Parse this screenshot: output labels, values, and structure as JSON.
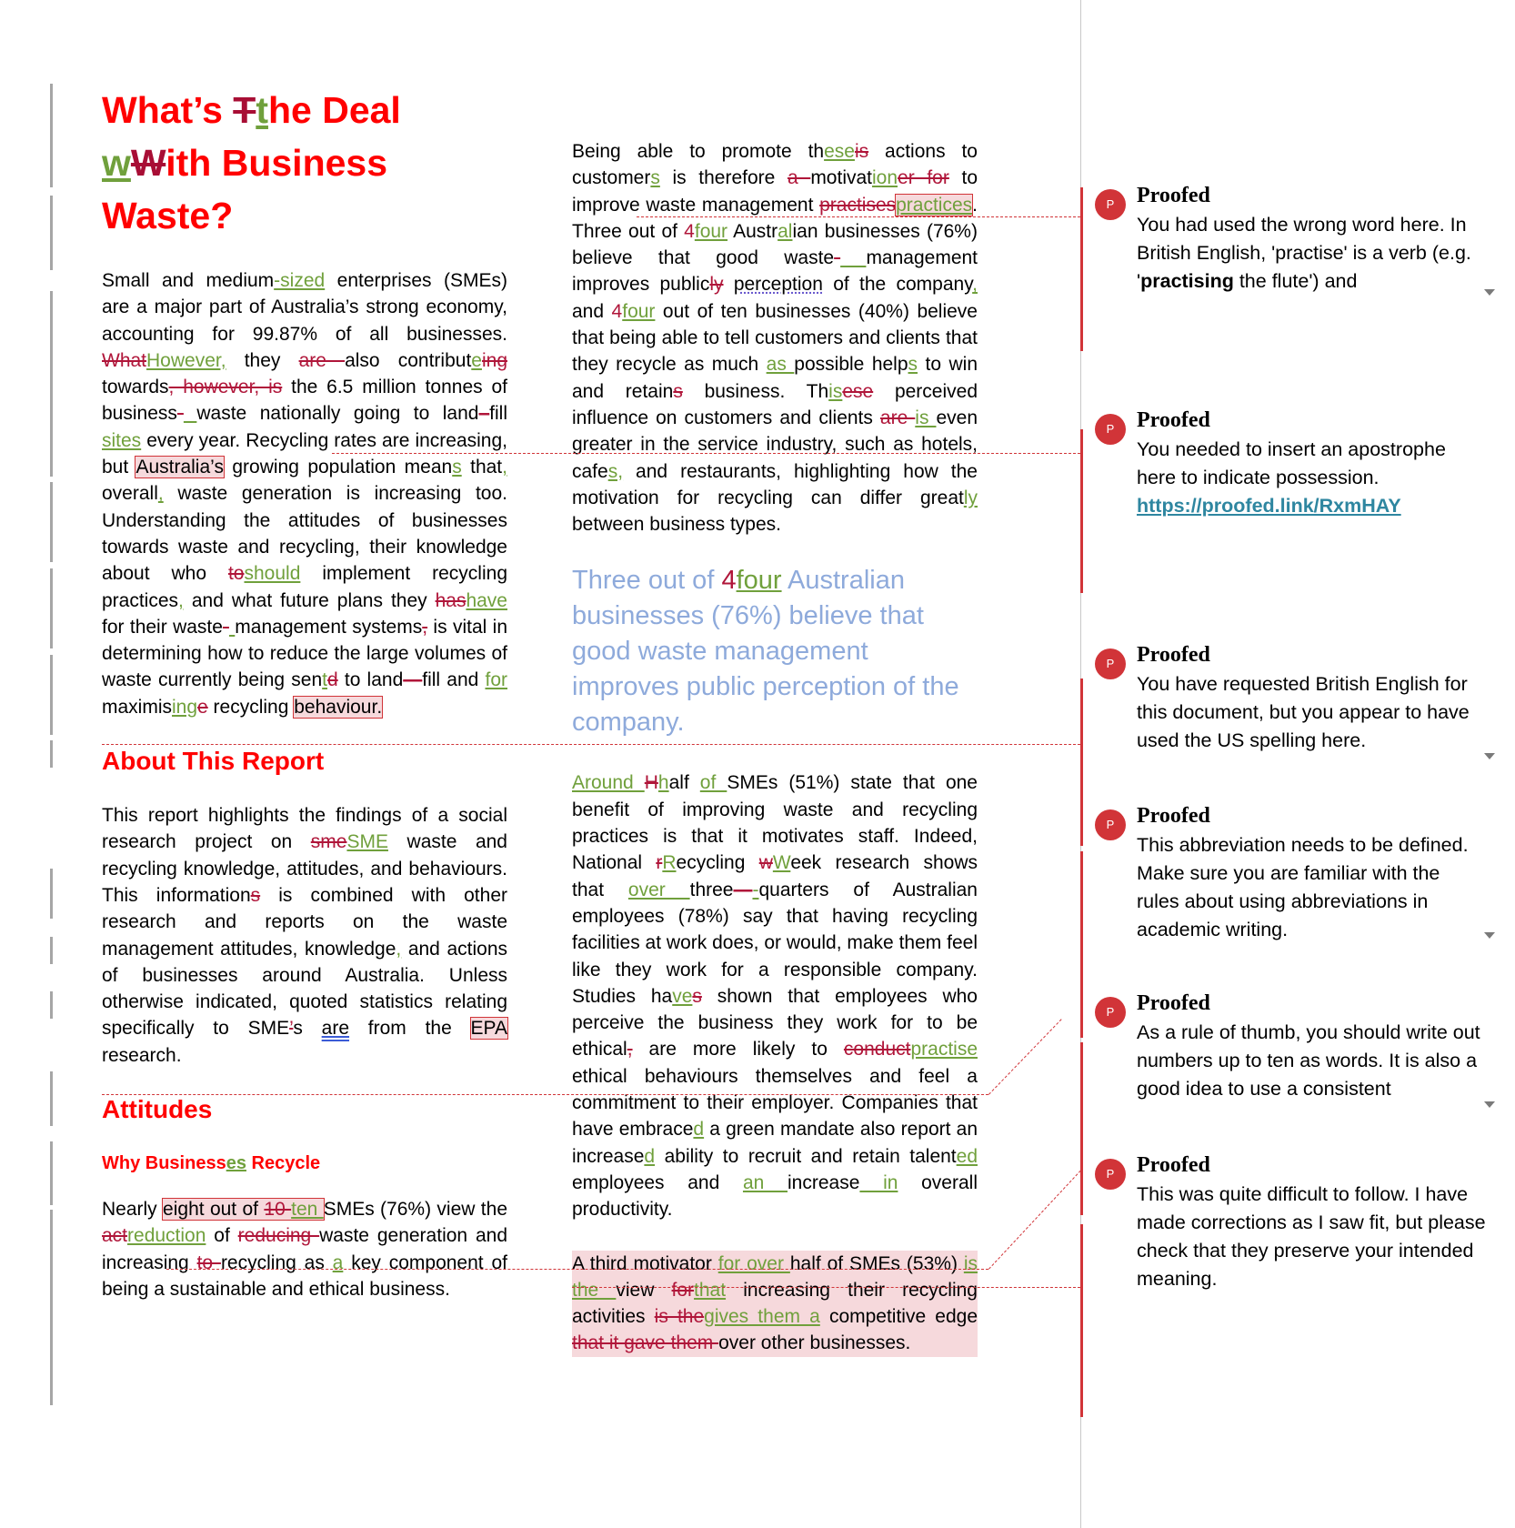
{
  "document": {
    "title_segments": [
      {
        "t": "text",
        "v": "What’s "
      },
      {
        "t": "del",
        "v": "T"
      },
      {
        "t": "ins",
        "v": "t"
      },
      {
        "t": "text",
        "v": "he Deal "
      },
      {
        "t": "ins",
        "v": "w"
      },
      {
        "t": "del",
        "v": "W"
      },
      {
        "t": "text",
        "v": "ith Business Waste?"
      }
    ],
    "left_column": [
      {
        "kind": "para",
        "segments": [
          {
            "t": "text",
            "v": "Small and medium"
          },
          {
            "t": "ins",
            "v": "-sized"
          },
          {
            "t": "text",
            "v": " enterprises (SMEs) are a major part of Australia’s strong economy, accounting for 99.87% of all businesses. "
          },
          {
            "t": "del",
            "v": "What"
          },
          {
            "t": "ins",
            "v": "However,"
          },
          {
            "t": "text",
            "v": " they "
          },
          {
            "t": "del",
            "v": "are "
          },
          {
            "t": "text",
            "v": "also contribut"
          },
          {
            "t": "ins",
            "v": "e"
          },
          {
            "t": "del",
            "v": "ing"
          },
          {
            "t": "text",
            "v": " towards"
          },
          {
            "t": "del",
            "v": ", however, is"
          },
          {
            "t": "text",
            "v": " the 6.5 million tonnes of business"
          },
          {
            "t": "del",
            "v": "-"
          },
          {
            "t": "ins",
            "v": " "
          },
          {
            "t": "text",
            "v": "waste nationally going to land"
          },
          {
            "t": "del",
            "v": "–"
          },
          {
            "t": "text",
            "v": "fill"
          },
          {
            "t": "ins",
            "v": " sites"
          },
          {
            "t": "text",
            "v": " every year. Recycling rates are increasing, but "
          },
          {
            "t": "anchor",
            "v": "Australia’s",
            "c": 1
          },
          {
            "t": "text",
            "v": " growing population mean"
          },
          {
            "t": "ins",
            "v": "s"
          },
          {
            "t": "text",
            "v": " that"
          },
          {
            "t": "ins",
            "v": ","
          },
          {
            "t": "text",
            "v": " overall"
          },
          {
            "t": "ins",
            "v": ","
          },
          {
            "t": "text",
            "v": " waste generation is increasing too. Understanding the attitudes of businesses towards waste and recycling, their knowledge about who "
          },
          {
            "t": "del",
            "v": "to"
          },
          {
            "t": "ins",
            "v": "should"
          },
          {
            "t": "text",
            "v": " implement recycling practices"
          },
          {
            "t": "ins",
            "v": ","
          },
          {
            "t": "text",
            "v": " and what future plans they "
          },
          {
            "t": "del",
            "v": "has"
          },
          {
            "t": "ins",
            "v": "have"
          },
          {
            "t": "text",
            "v": " for their waste"
          },
          {
            "t": "del",
            "v": "-"
          },
          {
            "t": "ins",
            "v": " "
          },
          {
            "t": "text",
            "v": "management systems"
          },
          {
            "t": "del",
            "v": ","
          },
          {
            "t": "text",
            "v": " is vital in determining how to reduce the large volumes of waste currently being sen"
          },
          {
            "t": "ins",
            "v": "t"
          },
          {
            "t": "del",
            "v": "d"
          },
          {
            "t": "text",
            "v": " to land"
          },
          {
            "t": "del",
            "v": "—"
          },
          {
            "t": "text",
            "v": "fill and "
          },
          {
            "t": "ins",
            "v": "for "
          },
          {
            "t": "text",
            "v": "maximis"
          },
          {
            "t": "ins",
            "v": "ing"
          },
          {
            "t": "del",
            "v": "e"
          },
          {
            "t": "text",
            "v": " recycling "
          },
          {
            "t": "anchor",
            "v": "behaviour.",
            "c": 2
          }
        ]
      },
      {
        "kind": "h2",
        "segments": [
          {
            "t": "text",
            "v": "About This Report"
          }
        ]
      },
      {
        "kind": "para",
        "segments": [
          {
            "t": "text",
            "v": "This report highlights the findings of a social research project on "
          },
          {
            "t": "del",
            "v": "sme"
          },
          {
            "t": "ins",
            "v": "SME"
          },
          {
            "t": "text",
            "v": " waste and recycling knowledge, attitudes, and behaviours. This information"
          },
          {
            "t": "del",
            "v": "s"
          },
          {
            "t": "text",
            "v": " is combined with other research and reports on the waste management attitudes, knowledge"
          },
          {
            "t": "ins",
            "v": ","
          },
          {
            "t": "text",
            "v": " and actions of businesses around Australia. Unless otherwise indicated, quoted statistics relating specifically to SME"
          },
          {
            "t": "del",
            "v": "’"
          },
          {
            "t": "text",
            "v": "s "
          },
          {
            "t": "blue",
            "v": "are"
          },
          {
            "t": "text",
            "v": " from the "
          },
          {
            "t": "anchor",
            "v": "EPA ",
            "c": 3
          },
          {
            "t": "text",
            "v": "research."
          }
        ]
      },
      {
        "kind": "h2",
        "segments": [
          {
            "t": "text",
            "v": "Attitudes"
          }
        ]
      },
      {
        "kind": "h3",
        "segments": [
          {
            "t": "text",
            "v": "Why Business"
          },
          {
            "t": "ins",
            "v": "es"
          },
          {
            "t": "text",
            "v": " Recycle"
          }
        ]
      },
      {
        "kind": "para",
        "segments": [
          {
            "t": "text",
            "v": "Nearly "
          },
          {
            "t": "anchor-group",
            "c": 4,
            "items": [
              {
                "t": "text",
                "v": "eight out of "
              },
              {
                "t": "del",
                "v": "10 "
              },
              {
                "t": "ins",
                "v": "ten "
              }
            ]
          },
          {
            "t": "text",
            "v": "SMEs (76%) view the "
          },
          {
            "t": "del",
            "v": "act"
          },
          {
            "t": "ins",
            "v": "reduction"
          },
          {
            "t": "text",
            "v": " of "
          },
          {
            "t": "del",
            "v": "reducing "
          },
          {
            "t": "text",
            "v": "waste generation and increasing "
          },
          {
            "t": "del",
            "v": "to "
          },
          {
            "t": "text",
            "v": "recycling as "
          },
          {
            "t": "ins",
            "v": "a"
          },
          {
            "t": "text",
            "v": " key component of being a sustainable and ethical business."
          }
        ]
      }
    ],
    "middle_column": [
      {
        "kind": "para",
        "segments": [
          {
            "t": "text",
            "v": "Being able to promote th"
          },
          {
            "t": "ins",
            "v": "ese"
          },
          {
            "t": "del",
            "v": "is"
          },
          {
            "t": "text",
            "v": " actions to customer"
          },
          {
            "t": "ins",
            "v": "s"
          },
          {
            "t": "text",
            "v": " is therefore "
          },
          {
            "t": "del",
            "v": "a "
          },
          {
            "t": "text",
            "v": "motivat"
          },
          {
            "t": "ins",
            "v": "ion"
          },
          {
            "t": "del",
            "v": "er for"
          },
          {
            "t": "text",
            "v": " to improve waste management "
          },
          {
            "t": "del",
            "v": "practises"
          },
          {
            "t": "anchor-ins",
            "v": "practices",
            "c": 0
          },
          {
            "t": "text",
            "v": ". Three out of "
          },
          {
            "t": "del-num",
            "v": "4"
          },
          {
            "t": "ins",
            "v": "four"
          },
          {
            "t": "text",
            "v": " Austr"
          },
          {
            "t": "ins",
            "v": "al"
          },
          {
            "t": "text",
            "v": "ian businesses (76%) believe that good waste"
          },
          {
            "t": "del",
            "v": "-"
          },
          {
            "t": "ins",
            "v": " "
          },
          {
            "t": "text",
            "v": "management improves public"
          },
          {
            "t": "del",
            "v": "ly"
          },
          {
            "t": "text",
            "v": " "
          },
          {
            "t": "dotted",
            "v": "perception"
          },
          {
            "t": "text",
            "v": " of the company"
          },
          {
            "t": "ins",
            "v": ","
          },
          {
            "t": "text",
            "v": " and "
          },
          {
            "t": "del-num",
            "v": "4"
          },
          {
            "t": "ins",
            "v": "four"
          },
          {
            "t": "text",
            "v": " out of ten businesses (40%) believe that being able to tell customers and clients that they recycle as much "
          },
          {
            "t": "ins",
            "v": "as "
          },
          {
            "t": "text",
            "v": "possible help"
          },
          {
            "t": "ins",
            "v": "s"
          },
          {
            "t": "text",
            "v": " to win and retain"
          },
          {
            "t": "del",
            "v": "s"
          },
          {
            "t": "text",
            "v": " business. Th"
          },
          {
            "t": "ins",
            "v": "is"
          },
          {
            "t": "del",
            "v": "ese"
          },
          {
            "t": "text",
            "v": " perceived influence on customers and clients "
          },
          {
            "t": "del",
            "v": "are "
          },
          {
            "t": "ins",
            "v": "is "
          },
          {
            "t": "text",
            "v": "even greater in the service industry, such as hotels, cafe"
          },
          {
            "t": "ins",
            "v": "s,"
          },
          {
            "t": "text",
            "v": " and restaurants, highlighting how the motivation for recycling can differ great"
          },
          {
            "t": "ins",
            "v": "ly"
          },
          {
            "t": "text",
            "v": " between business types."
          }
        ]
      },
      {
        "kind": "pullquote",
        "segments": [
          {
            "t": "text",
            "v": "Three out of "
          },
          {
            "t": "del-num",
            "v": "4"
          },
          {
            "t": "ins",
            "v": "four"
          },
          {
            "t": "text",
            "v": " Australian businesses (76%) believe that good waste management improves public perception of the company."
          }
        ]
      },
      {
        "kind": "para",
        "segments": [
          {
            "t": "ins",
            "v": "Around "
          },
          {
            "t": "del",
            "v": "H"
          },
          {
            "t": "ins",
            "v": "h"
          },
          {
            "t": "text",
            "v": "alf "
          },
          {
            "t": "ins",
            "v": "of "
          },
          {
            "t": "text",
            "v": "SMEs (51%) state that one benefit of improving waste and recycling practices is that it motivates staff. Indeed, National "
          },
          {
            "t": "del",
            "v": "r"
          },
          {
            "t": "ins",
            "v": "R"
          },
          {
            "t": "text",
            "v": "ecycling "
          },
          {
            "t": "del",
            "v": "w"
          },
          {
            "t": "ins",
            "v": "W"
          },
          {
            "t": "text",
            "v": "eek research shows that "
          },
          {
            "t": "ins",
            "v": "over "
          },
          {
            "t": "text",
            "v": " three"
          },
          {
            "t": "del",
            "v": "—"
          },
          {
            "t": "ins",
            "v": "-"
          },
          {
            "t": "text",
            "v": "quarters of Australian employees (78%) say that having recycling facilities at work does, or would, make them feel like they work for a responsible company. Studies ha"
          },
          {
            "t": "ins",
            "v": "ve"
          },
          {
            "t": "del",
            "v": "s"
          },
          {
            "t": "text",
            "v": " shown that employees who perceive the business they work for to be ethical"
          },
          {
            "t": "del",
            "v": ","
          },
          {
            "t": "text",
            "v": " are more likely to "
          },
          {
            "t": "del",
            "v": "conduct"
          },
          {
            "t": "ins",
            "v": "practise"
          },
          {
            "t": "text",
            "v": " ethical behaviours themselves and feel a commitment to their employer. Companies that have embrace"
          },
          {
            "t": "ins",
            "v": "d"
          },
          {
            "t": "text",
            "v": " a green mandate also report an increase"
          },
          {
            "t": "ins",
            "v": "d"
          },
          {
            "t": "text",
            "v": " ability to recruit and retain talent"
          },
          {
            "t": "ins",
            "v": "ed"
          },
          {
            "t": "text",
            "v": " employees and "
          },
          {
            "t": "ins",
            "v": "an "
          },
          {
            "t": "text",
            "v": " increase"
          },
          {
            "t": "ins",
            "v": " in"
          },
          {
            "t": "text",
            "v": " overall productivity."
          }
        ]
      },
      {
        "kind": "para-hl",
        "segments": [
          {
            "t": "text",
            "v": "A third motivator "
          },
          {
            "t": "ins",
            "v": "for over "
          },
          {
            "t": "text",
            "v": "half of SMEs (53%) "
          },
          {
            "t": "ins",
            "v": "is the "
          },
          {
            "t": "text",
            "v": "view "
          },
          {
            "t": "del",
            "v": "for"
          },
          {
            "t": "ins",
            "v": "that"
          },
          {
            "t": "text",
            "v": " increasing their recycling activities "
          },
          {
            "t": "del",
            "v": "is the"
          },
          {
            "t": "ins",
            "v": "gives them a"
          },
          {
            "t": "text",
            "v": " competitive edge "
          },
          {
            "t": "del",
            "v": "that it gave them "
          },
          {
            "t": "text",
            "v": "over other businesses."
          }
        ]
      }
    ]
  },
  "comments": [
    {
      "author": "Proofed",
      "avatar": "P",
      "text": "You had used the wrong word here. In British English, 'practise' is a verb (e.g. '",
      "bold": "practising",
      "text_after": " the flute') and",
      "expandable": true
    },
    {
      "author": "Proofed",
      "avatar": "P",
      "text": "You needed to insert an apostrophe here to indicate possession.",
      "link": "https://proofed.link/RxmHAY",
      "expandable": false
    },
    {
      "author": "Proofed",
      "avatar": "P",
      "text": "You have requested British English for this document, but you appear to have used the US spelling here.",
      "expandable": true
    },
    {
      "author": "Proofed",
      "avatar": "P",
      "text": "This abbreviation needs to be defined. Make sure you are familiar with the rules about using abbreviations in academic writing.",
      "expandable": true
    },
    {
      "author": "Proofed",
      "avatar": "P",
      "text": "As a rule of thumb, you should write out numbers up to ten as words. It is also a good idea to use a consistent",
      "expandable": true
    },
    {
      "author": "Proofed",
      "avatar": "P",
      "text": "This was quite difficult to follow. I have made corrections as I saw fit, but please check that they preserve your intended meaning.",
      "expandable": false
    }
  ],
  "colors": {
    "heading": "#ff0000",
    "deletion": "#b0163a",
    "insertion": "#70a03c",
    "comment_accent": "#d13438",
    "pullquote": "#8eaadb",
    "link": "#2e86a0"
  }
}
